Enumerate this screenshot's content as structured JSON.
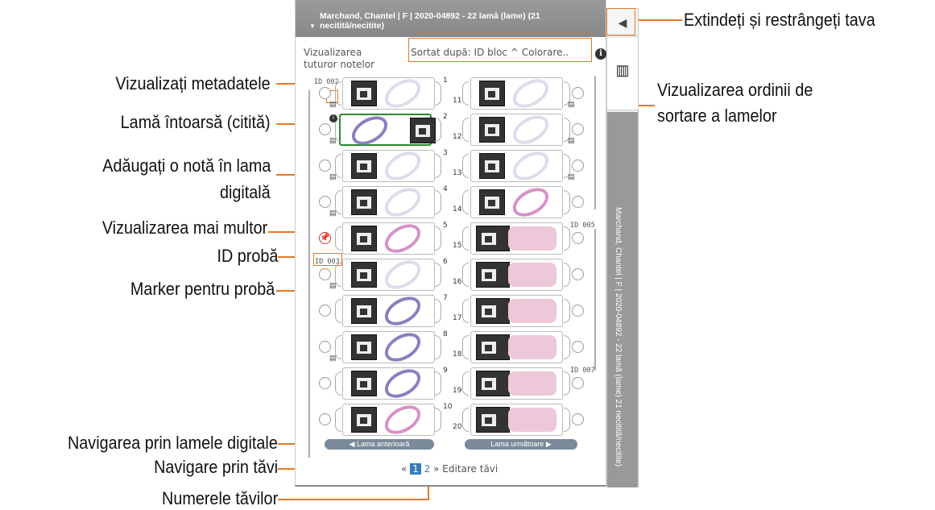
{
  "callouts": {
    "expand_tray": "Extindeți și restrângeți tava",
    "sort_order": [
      "Vizualizarea ordinii de",
      "sortare a lamelor"
    ],
    "view_metadata": "Vizualizați metadatele",
    "slide_flipped": "Lamă întoarsă (citită)",
    "add_note": [
      "Adăugați o notă în lama",
      "digitală"
    ],
    "view_multiple": "Vizualizarea mai multor",
    "specimen_id": "ID probă",
    "specimen_marker": "Marker pentru probă",
    "nav_slides": "Navigarea prin lamele digitale",
    "nav_trays": "Navigare prin tăvi",
    "tray_numbers": "Numerele tăvilor"
  },
  "panel": {
    "header": "Marchand, Chantel | F | 2020-04892 - 22 lamă (lame) (21 necitită/necitite)",
    "view_all_notes": [
      "Vizualizarea",
      "tuturor notelor"
    ],
    "sort_label": "Sortat după:",
    "sort_value": "ID bloc",
    "sort_stain": "Colorare..",
    "prev_button": "Lama anterioară",
    "next_button": "Lama următoare",
    "pager": {
      "prev": "«",
      "current": "1",
      "next_page": "2",
      "next": "»",
      "edit": "Editare tăvi"
    },
    "id_labels": {
      "top": "ID 002",
      "mid": "ID 003",
      "r1": "ID 005",
      "r2": "ID 007"
    },
    "left_numbers": [
      "1",
      "2",
      "3",
      "4",
      "5",
      "6",
      "7",
      "8",
      "9",
      "10"
    ],
    "right_numbers": [
      "11",
      "12",
      "13",
      "14",
      "15",
      "16",
      "17",
      "18",
      "19",
      "20"
    ]
  },
  "sidebar": {
    "vertical_label": "Marchand, Chantel | F | 2020-04892 - 22 lamă (lame) 21 necitită/necitite)"
  },
  "colors": {
    "accent": "#e87722",
    "header": "#8c8c8c",
    "selected": "#2a8a2a"
  },
  "icons": {
    "collapse": "triangle-left-icon",
    "layout": "columns-icon",
    "info": "info-icon",
    "note": "note-icon",
    "pin": "pushpin-icon"
  }
}
